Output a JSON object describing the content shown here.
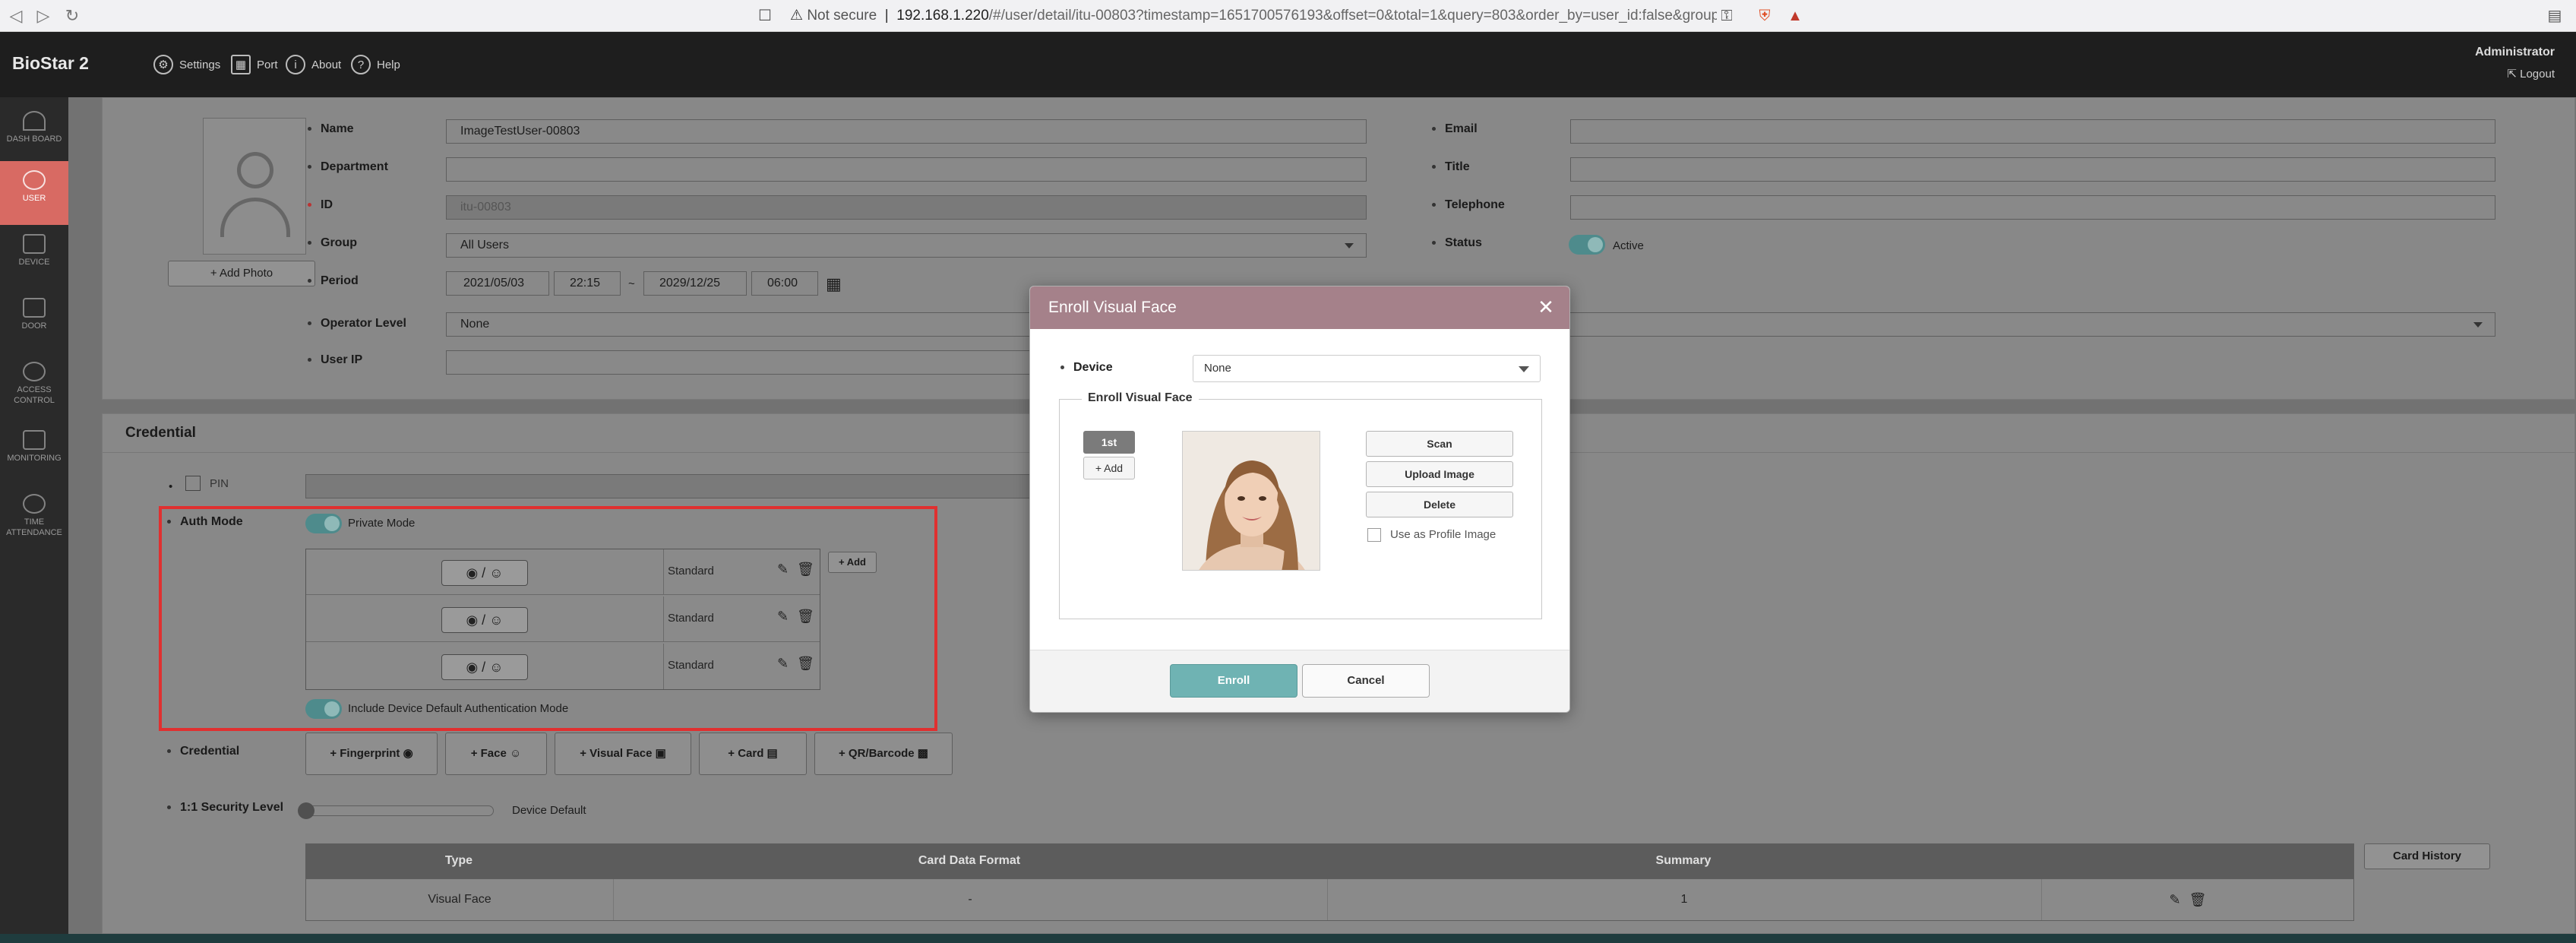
{
  "browser": {
    "not_secure": "Not secure",
    "url_host": "192.168.1.220",
    "url_path": "/#/user/detail/itu-00803?timestamp=1651700576193&offset=0&total=1&query=803&order_by=user_id:false&group_id=..."
  },
  "app": {
    "logo": "BioStar 2",
    "nav": {
      "settings": "Settings",
      "port": "Port",
      "about": "About",
      "help": "Help"
    },
    "user": "Administrator",
    "logout": "Logout"
  },
  "sidebar": {
    "items": [
      {
        "label": "DASH BOARD"
      },
      {
        "label": "USER"
      },
      {
        "label": "DEVICE"
      },
      {
        "label": "DOOR"
      },
      {
        "label": "ACCESS CONTROL"
      },
      {
        "label": "MONITORING"
      },
      {
        "label": "TIME ATTENDANCE"
      }
    ]
  },
  "user_form": {
    "add_photo": "+ Add Photo",
    "name_label": "Name",
    "name_value": "ImageTestUser-00803",
    "department_label": "Department",
    "department_value": "",
    "id_label": "ID",
    "id_value": "itu-00803",
    "group_label": "Group",
    "group_value": "All Users",
    "period_label": "Period",
    "period_start_date": "2021/05/03",
    "period_start_time": "22:15",
    "period_sep": "~",
    "period_end_date": "2029/12/25",
    "period_end_time": "06:00",
    "operator_label": "Operator Level",
    "operator_value": "None",
    "userip_label": "User IP",
    "userip_value": "",
    "email_label": "Email",
    "title_label": "Title",
    "telephone_label": "Telephone",
    "status_label": "Status",
    "status_value": "Active"
  },
  "credential": {
    "section_title": "Credential",
    "pin_label": "PIN",
    "auth_mode_label": "Auth Mode",
    "private_mode": "Private Mode",
    "auth_rows": [
      {
        "mode": "◉ / ☺",
        "level": "Standard"
      },
      {
        "mode": "◉ / ☺",
        "level": "Standard"
      },
      {
        "mode": "◉ / ☺",
        "level": "Standard"
      }
    ],
    "add_btn": "+ Add",
    "include_default": "Include Device Default Authentication Mode",
    "credential_label": "Credential",
    "buttons": {
      "fingerprint": "+ Fingerprint",
      "face": "+ Face",
      "visual_face": "+ Visual Face",
      "card": "+ Card",
      "qr": "+ QR/Barcode"
    },
    "security_label": "1:1 Security Level",
    "security_value": "Device Default",
    "security_level": 0,
    "table": {
      "headers": [
        "Type",
        "Card Data Format",
        "Summary",
        ""
      ],
      "rows": [
        [
          "Visual Face",
          "-",
          "1",
          ""
        ]
      ]
    },
    "card_history": "Card History"
  },
  "modal": {
    "title": "Enroll Visual Face",
    "device_label": "Device",
    "device_value": "None",
    "legend": "Enroll Visual Face",
    "tab_first": "1st",
    "add": "+ Add",
    "scan": "Scan",
    "upload": "Upload Image",
    "delete": "Delete",
    "use_profile": "Use as Profile Image",
    "enroll": "Enroll",
    "cancel": "Cancel"
  },
  "colors": {
    "modal_header": "#a5818a",
    "enroll_button": "#6fb3b3",
    "active_sidebar": "#d86a63",
    "highlight_box": "#e03030"
  }
}
